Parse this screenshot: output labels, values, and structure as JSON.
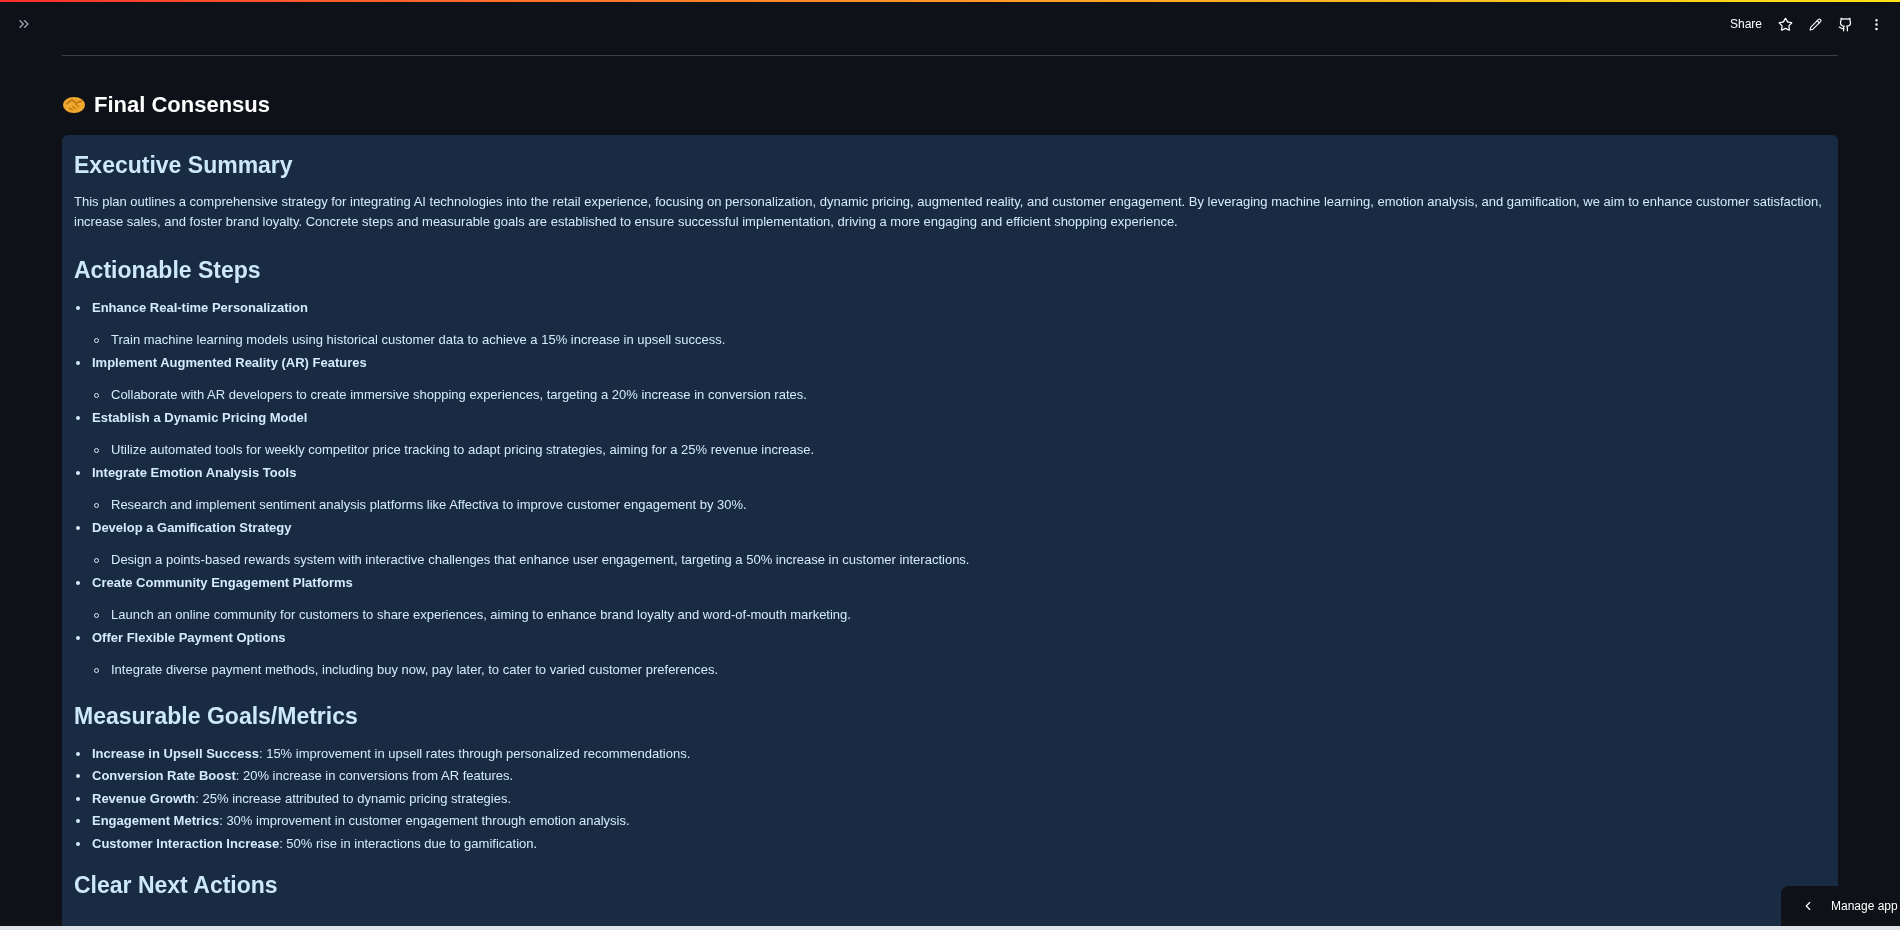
{
  "header": {
    "share_label": "Share"
  },
  "title": "Final Consensus",
  "summary": {
    "heading": "Executive Summary",
    "text": "This plan outlines a comprehensive strategy for integrating AI technologies into the retail experience, focusing on personalization, dynamic pricing, augmented reality, and customer engagement. By leveraging machine learning, emotion analysis, and gamification, we aim to enhance customer satisfaction, increase sales, and foster brand loyalty. Concrete steps and measurable goals are established to ensure successful implementation, driving a more engaging and efficient shopping experience."
  },
  "steps": {
    "heading": "Actionable Steps",
    "items": [
      {
        "title": "Enhance Real-time Personalization",
        "children": [
          "Train machine learning models using historical customer data to achieve a 15% increase in upsell success."
        ]
      },
      {
        "title": "Implement Augmented Reality (AR) Features",
        "children": [
          "Collaborate with AR developers to create immersive shopping experiences, targeting a 20% increase in conversion rates."
        ]
      },
      {
        "title": "Establish a Dynamic Pricing Model",
        "children": [
          "Utilize automated tools for weekly competitor price tracking to adapt pricing strategies, aiming for a 25% revenue increase."
        ]
      },
      {
        "title": "Integrate Emotion Analysis Tools",
        "children": [
          "Research and implement sentiment analysis platforms like Affectiva to improve customer engagement by 30%."
        ]
      },
      {
        "title": "Develop a Gamification Strategy",
        "children": [
          "Design a points-based rewards system with interactive challenges that enhance user engagement, targeting a 50% increase in customer interactions."
        ]
      },
      {
        "title": "Create Community Engagement Platforms",
        "children": [
          "Launch an online community for customers to share experiences, aiming to enhance brand loyalty and word-of-mouth marketing."
        ]
      },
      {
        "title": "Offer Flexible Payment Options",
        "children": [
          "Integrate diverse payment methods, including buy now, pay later, to cater to varied customer preferences."
        ]
      }
    ]
  },
  "metrics": {
    "heading": "Measurable Goals/Metrics",
    "items": [
      "**Increase in Upsell Success**: 15% improvement in upsell rates through personalized recommendations.",
      "**Conversion Rate Boost**: 20% increase in conversions from AR features.",
      "**Revenue Growth**: 25% increase attributed to dynamic pricing strategies.",
      "**Engagement Metrics**: 30% improvement in customer engagement through emotion analysis.",
      "**Customer Interaction Increase**: 50% rise in interactions due to gamification."
    ]
  },
  "next_actions": {
    "heading": "Clear Next Actions"
  },
  "manage_app": {
    "label": "Manage app"
  }
}
